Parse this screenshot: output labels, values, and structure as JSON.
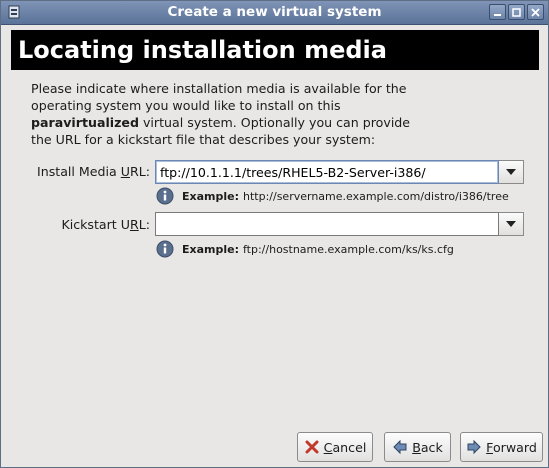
{
  "window": {
    "title": "Create a new virtual system"
  },
  "banner": {
    "heading": "Locating installation media"
  },
  "description": {
    "part1": "Please indicate where installation media is available for the operating system you would like to install on this",
    "emphasis": "paravirtualized",
    "part2": "virtual system. Optionally you can provide the URL for a kickstart file that describes your system:"
  },
  "install_media": {
    "label_before": "Install Media ",
    "label_mnemonic": "U",
    "label_after": "RL:",
    "value": "ftp://10.1.1.1/trees/RHEL5-B2-Server-i386/",
    "hint_title": "Example:",
    "hint_text": "http://servername.example.com/distro/i386/tree"
  },
  "kickstart": {
    "label_before": "Kickstart U",
    "label_mnemonic": "R",
    "label_after": "L:",
    "value": "",
    "hint_title": "Example:",
    "hint_text": "ftp://hostname.example.com/ks/ks.cfg"
  },
  "buttons": {
    "cancel": {
      "mnemonic": "C",
      "rest": "ancel"
    },
    "back": {
      "mnemonic": "B",
      "rest": "ack"
    },
    "forward": {
      "mnemonic": "F",
      "rest": "orward"
    }
  },
  "colors": {
    "titlebar": "#6c84a9",
    "banner": "#000000",
    "cancel_icon": "#c0392b",
    "info_icon": "#5a6f8e"
  },
  "icons": [
    "app-icon",
    "minimize-icon",
    "maximize-icon",
    "close-icon",
    "dropdown-arrow-icon",
    "info-icon",
    "cancel-x-icon",
    "back-arrow-icon",
    "forward-arrow-icon"
  ]
}
